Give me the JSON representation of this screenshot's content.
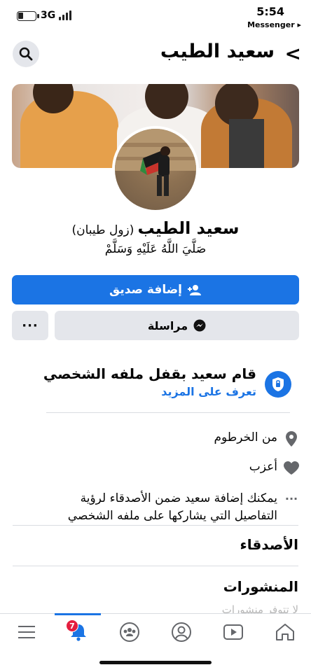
{
  "status_bar": {
    "network": "3G",
    "time": "5:54",
    "back_app": "Messenger ▸"
  },
  "header": {
    "title": "سعيد الطيب",
    "back_glyph": "<",
    "search_icon": "search-icon"
  },
  "profile": {
    "name": "سعيد الطيب",
    "alternate_name": "(زول طيبان)",
    "bio": "صَلَّيَ اللَّهُ عَلَيْهِ وَسَلَّمْ"
  },
  "actions": {
    "add_friend": "إضافة صديق",
    "message": "مراسلة",
    "more": "···"
  },
  "locked_notice": {
    "title": "قام سعيد بقفل ملفه الشخصي",
    "link": "تعرف على المزيد"
  },
  "intro": [
    {
      "icon": "location-pin-icon",
      "text": "من الخرطوم"
    },
    {
      "icon": "heart-icon",
      "text": "أعزب"
    },
    {
      "icon": "more-dots-icon",
      "text": "يمكنك إضافة سعيد ضمن الأصدقاء لرؤية التفاصيل التي يشاركها على ملفه الشخصي"
    }
  ],
  "sections": {
    "friends": "الأصدقاء",
    "posts": "المنشورات",
    "posts_empty": "لا تتوفر منشورات"
  },
  "tabbar": {
    "notifications_badge": "7",
    "active_tab": "notifications",
    "tabs": [
      "menu-icon",
      "notifications-bell-icon",
      "groups-icon",
      "profile-icon",
      "watch-icon",
      "home-icon"
    ]
  },
  "colors": {
    "accent": "#1b74e4",
    "badge": "#e41e3f",
    "button_bg": "#e4e6eb"
  }
}
